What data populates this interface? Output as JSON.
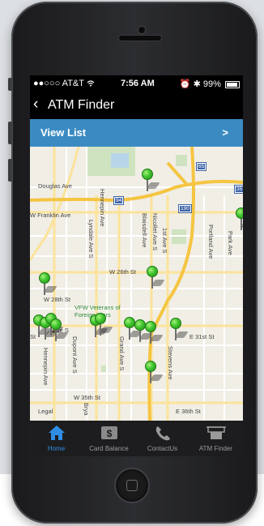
{
  "status_bar": {
    "carrier": "●●○○○ AT&T",
    "time": "7:56 AM",
    "battery": "99%"
  },
  "nav": {
    "back_glyph": "‹",
    "title": "ATM Finder"
  },
  "view_list": {
    "label": "View List",
    "arrow": ">"
  },
  "map": {
    "streets": {
      "douglas": "Douglas Ave",
      "franklin": "W Franklin Ave",
      "lyndale": "Lyndale Ave S",
      "blaisdell": "Blaisdell Ave",
      "first_ave": "1st Ave S",
      "nicollet": "Nicollet Ave S",
      "portland": "Portland Ave",
      "park": "Park Ave",
      "w26": "W 26th St",
      "w28": "W 28th St",
      "grand": "Grand Ave S",
      "dupont": "Dupont Ave S",
      "hennepin_lower": "Hennepin Ave",
      "hennepin_upper": "Hennepin Ave",
      "stevens": "Stevens Ave",
      "e31": "E 31st St",
      "w35": "W 35th St",
      "e36": "E 36th St",
      "st": "St",
      "ave_s": "Ave S",
      "bryant": "Brya"
    },
    "shields": {
      "i94": "94",
      "i65": "65",
      "i190": "190",
      "i35": "35"
    },
    "landmark": "VFW Veterans of Foreign Wars",
    "legal": "Legal"
  },
  "tabs": [
    {
      "label": "Home",
      "icon": "home-icon",
      "active": true
    },
    {
      "label": "Card Balance",
      "icon": "dollar-icon",
      "active": false
    },
    {
      "label": "ContactUs",
      "icon": "phone-icon",
      "active": false
    },
    {
      "label": "ATM Finder",
      "icon": "atm-icon",
      "active": false
    }
  ],
  "colors": {
    "accent": "#3b8bc2",
    "tab_active": "#2f8de4",
    "pin": "#3fc52e",
    "highway": "#f5c542"
  }
}
